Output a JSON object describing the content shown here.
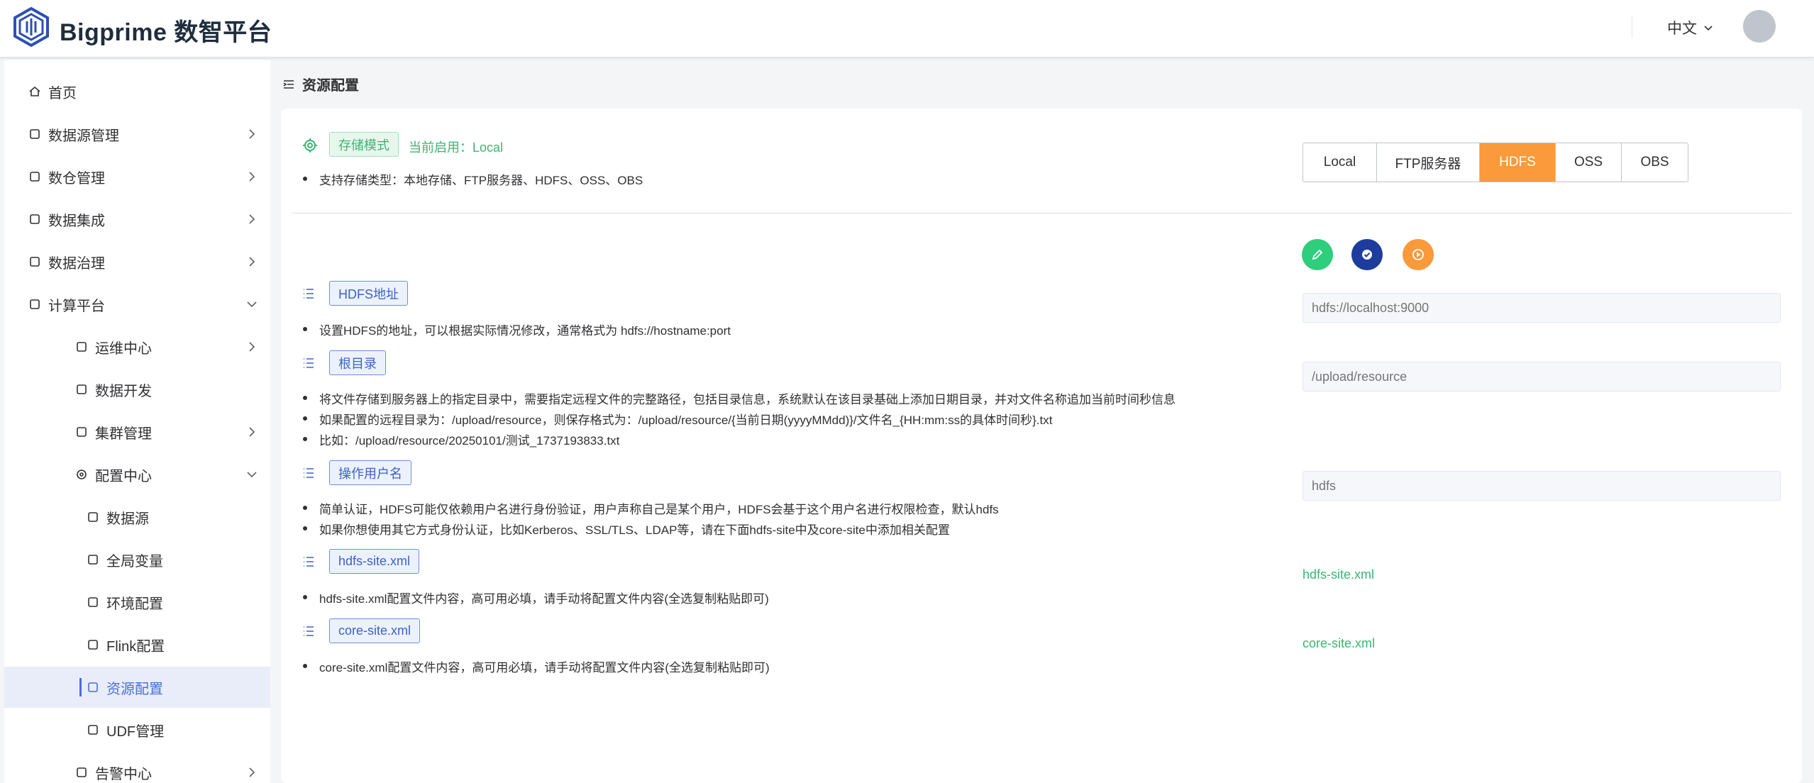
{
  "header": {
    "title": "Bigprime 数智平台",
    "lang": "中文"
  },
  "breadcrumb": {
    "title": "资源配置"
  },
  "sidebar": {
    "items": [
      {
        "label": "首页"
      },
      {
        "label": "数据源管理"
      },
      {
        "label": "数仓管理"
      },
      {
        "label": "数据集成"
      },
      {
        "label": "数据治理"
      },
      {
        "label": "计算平台"
      },
      {
        "label": "运维中心"
      },
      {
        "label": "数据开发"
      },
      {
        "label": "集群管理"
      },
      {
        "label": "配置中心"
      },
      {
        "label": "数据源"
      },
      {
        "label": "全局变量"
      },
      {
        "label": "环境配置"
      },
      {
        "label": "Flink配置"
      },
      {
        "label": "资源配置"
      },
      {
        "label": "UDF管理"
      },
      {
        "label": "告警中心"
      }
    ]
  },
  "storage": {
    "tag": "存储模式",
    "current": "当前启用：Local",
    "support": "支持存储类型：本地存储、FTP服务器、HDFS、OSS、OBS",
    "buttons": [
      {
        "label": "Local",
        "active": false
      },
      {
        "label": "FTP服务器",
        "active": false
      },
      {
        "label": "HDFS",
        "active": true
      },
      {
        "label": "OSS",
        "active": false
      },
      {
        "label": "OBS",
        "active": false
      }
    ]
  },
  "sections": {
    "hdfs_address": {
      "tag": "HDFS地址",
      "lines": [
        "设置HDFS的地址，可以根据实际情况修改，通常格式为 hdfs://hostname:port"
      ],
      "placeholder": "hdfs://localhost:9000"
    },
    "root_dir": {
      "tag": "根目录",
      "lines": [
        "将文件存储到服务器上的指定目录中，需要指定远程文件的完整路径，包括目录信息，系统默认在该目录基础上添加日期目录，并对文件名称追加当前时间秒信息",
        "如果配置的远程目录为：/upload/resource，则保存格式为：/upload/resource/{当前日期(yyyyMMdd)}/文件名_{HH:mm:ss的具体时间秒}.txt",
        "比如：/upload/resource/20250101/测试_1737193833.txt"
      ],
      "placeholder": "/upload/resource"
    },
    "user": {
      "tag": "操作用户名",
      "lines": [
        "简单认证，HDFS可能仅依赖用户名进行身份验证，用户声称自己是某个用户，HDFS会基于这个用户名进行权限检查，默认hdfs",
        "如果你想使用其它方式身份认证，比如Kerberos、SSL/TLS、LDAP等，请在下面hdfs-site中及core-site中添加相关配置"
      ],
      "placeholder": "hdfs"
    },
    "hdfs_site": {
      "tag": "hdfs-site.xml",
      "lines": [
        "hdfs-site.xml配置文件内容，高可用必填，请手动将配置文件内容(全选复制粘贴即可)"
      ],
      "link": "hdfs-site.xml"
    },
    "core_site": {
      "tag": "core-site.xml",
      "lines": [
        "core-site.xml配置文件内容，高可用必填，请手动将配置文件内容(全选复制粘贴即可)"
      ],
      "link": "core-site.xml"
    }
  },
  "colors": {
    "accent_orange": "#fa9a3a",
    "green": "#3bb573",
    "blue": "#3d62c7",
    "dark_blue": "#1d3c9e"
  }
}
